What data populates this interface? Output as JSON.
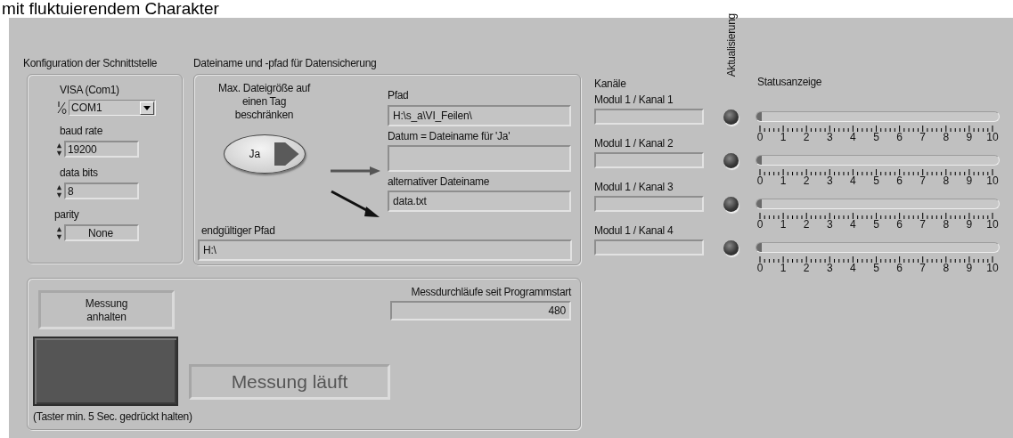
{
  "caption": "mit fluktuierendem Charakter",
  "interface_group": {
    "title": "Konfiguration der Schnittstelle",
    "visa": {
      "label": "VISA (Com1)",
      "value": "COM1"
    },
    "baud_rate": {
      "label": "baud rate",
      "value": "19200"
    },
    "data_bits": {
      "label": "data bits",
      "value": "8"
    },
    "parity": {
      "label": "parity",
      "value": "None"
    }
  },
  "file_group": {
    "title": "Dateiname und -pfad für Datensicherung",
    "limit_switch": {
      "lines": [
        "Max. Dateigröße auf",
        "einen Tag",
        "beschränken"
      ],
      "text": "Ja",
      "on": true
    },
    "path": {
      "label": "Pfad",
      "value": "H:\\s_a\\VI_Feilen\\"
    },
    "date_name": {
      "label": "Datum = Dateiname für 'Ja'"
    },
    "alt_name": {
      "label": "alternativer Dateiname",
      "value": "data.txt"
    },
    "final_path": {
      "label": "endgültiger Pfad",
      "value": "H:\\"
    }
  },
  "measurement": {
    "stop_lines": [
      "Messung",
      "anhalten"
    ],
    "stop_button": {
      "pressed": false
    },
    "hint": "(Taster min. 5 Sec. gedrückt halten)",
    "status": "Messung läuft",
    "counter": {
      "label": "Messdurchläufe seit Programmstart",
      "value": "480"
    }
  },
  "channels_header": "Kanäle",
  "update_header": "Aktualisierung",
  "status_header": "Statusanzeige",
  "channels": [
    {
      "name": "Modul 1 / Kanal 1",
      "on": false,
      "level": 0,
      "scale": [
        "0",
        "1",
        "2",
        "3",
        "4",
        "5",
        "6",
        "7",
        "8",
        "9",
        "10"
      ]
    },
    {
      "name": "Modul 1 / Kanal 2",
      "on": false,
      "level": 0,
      "scale": [
        "0",
        "1",
        "2",
        "3",
        "4",
        "5",
        "6",
        "7",
        "8",
        "9",
        "10"
      ]
    },
    {
      "name": "Modul 1 / Kanal 3",
      "on": false,
      "level": 0,
      "scale": [
        "0",
        "1",
        "2",
        "3",
        "4",
        "5",
        "6",
        "7",
        "8",
        "9",
        "10"
      ]
    },
    {
      "name": "Modul 1 / Kanal 4",
      "on": false,
      "level": 0,
      "scale": [
        "0",
        "1",
        "2",
        "3",
        "4",
        "5",
        "6",
        "7",
        "8",
        "9",
        "10"
      ]
    }
  ]
}
